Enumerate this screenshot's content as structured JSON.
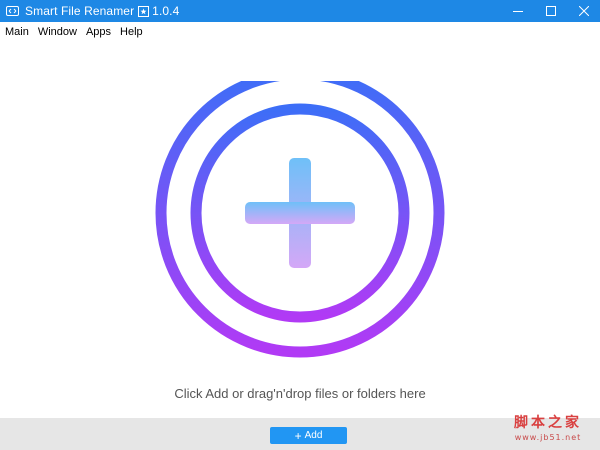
{
  "window": {
    "title": "Smart File Renamer",
    "version": "1.0.4",
    "icons": [
      "app-icon",
      "minimize-icon",
      "maximize-icon",
      "close-icon"
    ]
  },
  "menu": {
    "items": [
      "Main",
      "Window",
      "Apps",
      "Help"
    ]
  },
  "dropzone": {
    "hint": "Click Add or drag'n'drop files or folders here",
    "graphic_icon": "add-circle-icon",
    "colors": {
      "ring_top": "#3d6ef7",
      "ring_bottom": "#b13af5",
      "plus_top": "#6fc0f8",
      "plus_bottom": "#d4a8f7"
    }
  },
  "footer": {
    "add_label": "Add",
    "add_icon": "plus-icon"
  },
  "watermark": {
    "text": "脚本之家",
    "url": "www.jb51.net"
  },
  "colors": {
    "titlebar": "#1e88e5",
    "accent_button": "#2196f3",
    "bottombar": "#e6e6e6"
  }
}
